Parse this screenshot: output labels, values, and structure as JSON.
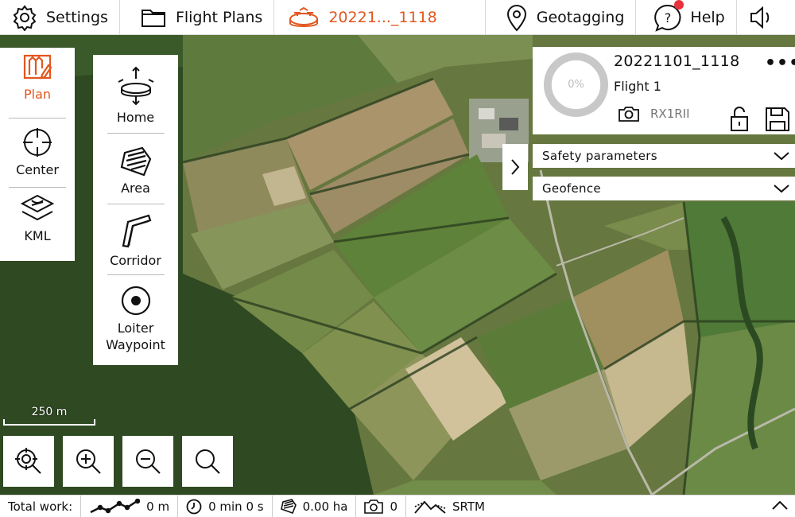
{
  "topbar": {
    "settings_label": "Settings",
    "flight_plans_label": "Flight Plans",
    "current_plan_label": "20221..._1118",
    "geotagging_label": "Geotagging",
    "help_label": "Help",
    "accent_color": "#e2571e",
    "notification_color": "#e8313b"
  },
  "tools_primary": [
    {
      "label": "Plan",
      "icon": "plan-icon",
      "active": true
    },
    {
      "label": "Center",
      "icon": "crosshair-icon"
    },
    {
      "label": "KML",
      "icon": "kml-icon"
    }
  ],
  "tools_secondary": [
    {
      "label": "Home",
      "icon": "home-drone-icon"
    },
    {
      "label": "Area",
      "icon": "area-icon"
    },
    {
      "label": "Corridor",
      "icon": "corridor-icon"
    },
    {
      "label": "Loiter\nWaypoint",
      "icon": "loiter-waypoint-icon"
    }
  ],
  "flight_panel": {
    "progress": 0,
    "progress_label": "0%",
    "flight_name": "20221101_1118",
    "flight_subtitle": "Flight 1",
    "camera": "RX1RII",
    "more_label": "•••"
  },
  "accordions": {
    "safety_label": "Safety parameters",
    "geofence_label": "Geofence"
  },
  "scale_label": "250 m",
  "bottombar": {
    "total_label": "Total work:",
    "distance": "0 m",
    "time": "0 min 0 s",
    "area": "0.00 ha",
    "photos": "0",
    "elevation_source": "SRTM"
  }
}
